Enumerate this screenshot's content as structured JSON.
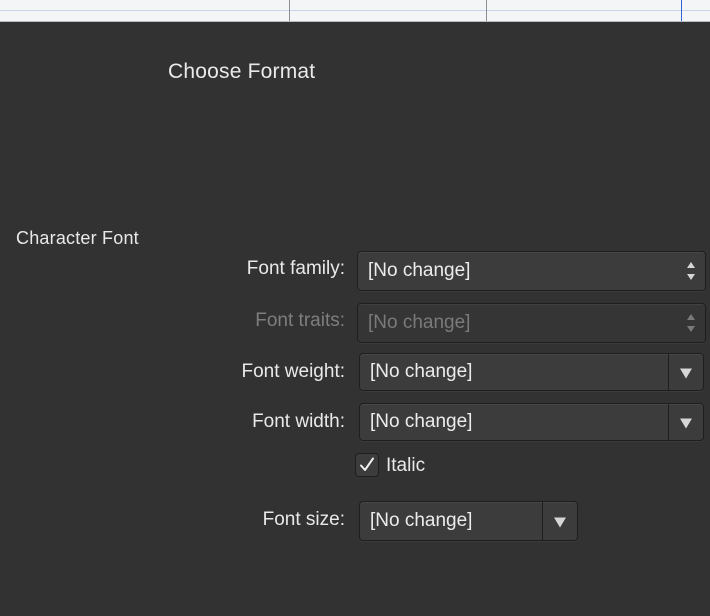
{
  "dialog": {
    "title": "Choose Format",
    "section_title": "Character Font"
  },
  "fields": {
    "font_family": {
      "label": "Font family:",
      "value": "[No change]"
    },
    "font_traits": {
      "label": "Font traits:",
      "value": "[No change]",
      "disabled": true
    },
    "font_weight": {
      "label": "Font weight:",
      "value": "[No change]"
    },
    "font_width": {
      "label": "Font width:",
      "value": "[No change]"
    },
    "italic": {
      "label": "Italic",
      "checked": true
    },
    "font_size": {
      "label": "Font size:",
      "value": "[No change]"
    }
  },
  "icons": {
    "stepper": "up-down-stepper-icon",
    "dropdown": "chevron-down-icon",
    "check": "checkmark-icon"
  }
}
